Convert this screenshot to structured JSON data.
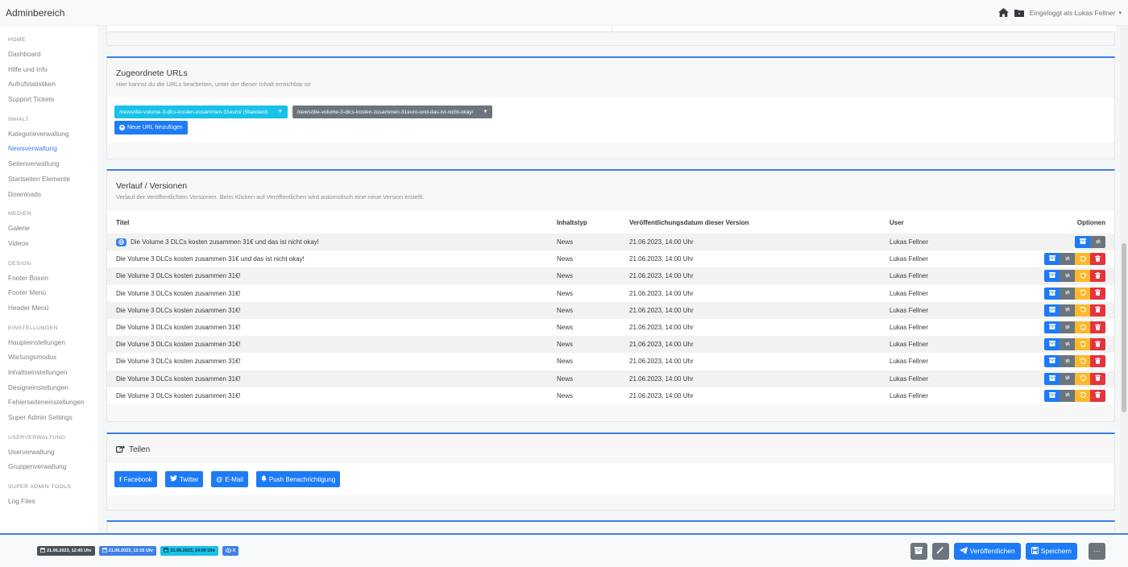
{
  "app": {
    "title": "Adminbereich",
    "user_label": "Eingeloggt als Lukas Fellner"
  },
  "sidebar": [
    {
      "heading": "HOME",
      "items": [
        "Dashboard",
        "Hilfe und Info",
        "Aufrufstatistiken",
        "Support Tickets"
      ]
    },
    {
      "heading": "INHALT",
      "items": [
        "Kategorieverwaltung",
        "Newsverwaltung",
        "Seitenverwaltung",
        "Startseiten Elemente",
        "Downloads"
      ]
    },
    {
      "heading": "MEDIEN",
      "items": [
        "Galerie",
        "Videos"
      ]
    },
    {
      "heading": "DESIGN",
      "items": [
        "Footer Boxen",
        "Footer Menü",
        "Header Menü"
      ]
    },
    {
      "heading": "EINSTELLUNGEN",
      "items": [
        "Haupteinstellungen",
        "Wartungsmodus",
        "Inhaltseinstellungen",
        "Designeinstellungen",
        "Fehlerseiteneinstellungen",
        "Super Admin Settings"
      ]
    },
    {
      "heading": "USERVERWALTUNG",
      "items": [
        "Userverwaltung",
        "Gruppenverwaltung"
      ]
    },
    {
      "heading": "SUPER ADMIN TOOLS",
      "items": [
        "Log Files"
      ]
    }
  ],
  "sidebar_active": "Newsverwaltung",
  "urls": {
    "title": "Zugeordnete URLs",
    "subtitle": "Hier kannst du die URLs bearbeiten, unter der dieser Inhalt erreichbar ist",
    "primary": "/news/die-volume-3-dlcs-kosten-zusammen-31euro/ (Standard)",
    "secondary": "/news/die-volume-3-dlcs-kosten-zusammen-31euro-und-das-ist-nicht-okay/",
    "add_label": "Neue URL hinzufügen"
  },
  "versions": {
    "title": "Verlauf / Versionen",
    "subtitle": "Verlauf der veröffentlichten Versionen. Beim Klicken auf Veröffentlichen wird automstisch eine neue Version erstellt.",
    "headers": {
      "title": "Titel",
      "type": "Inhaltstyp",
      "date": "Veröffentlichungsdatum dieser Version",
      "user": "User",
      "options": "Optionen"
    },
    "rows": [
      {
        "title": "Die Volume 3 DLCs kosten zusammen 31€ und das ist nicht okay!",
        "type": "News",
        "date": "21.06.2023, 14:00 Uhr",
        "user": "Lukas Fellner",
        "current": true
      },
      {
        "title": "Die Volume 3 DLCs kosten zusammen 31€ und das ist nicht okay!",
        "type": "News",
        "date": "21.06.2023, 14:00 Uhr",
        "user": "Lukas Fellner",
        "current": false
      },
      {
        "title": "Die Volume 3 DLCs kosten zusammen 31€!",
        "type": "News",
        "date": "21.06.2023, 14:00 Uhr",
        "user": "Lukas Fellner",
        "current": false
      },
      {
        "title": "Die Volume 3 DLCs kosten zusammen 31€!",
        "type": "News",
        "date": "21.06.2023, 14:00 Uhr",
        "user": "Lukas Fellner",
        "current": false
      },
      {
        "title": "Die Volume 3 DLCs kosten zusammen 31€!",
        "type": "News",
        "date": "21.06.2023, 14:00 Uhr",
        "user": "Lukas Fellner",
        "current": false
      },
      {
        "title": "Die Volume 3 DLCs kosten zusammen 31€!",
        "type": "News",
        "date": "21.06.2023, 14:00 Uhr",
        "user": "Lukas Fellner",
        "current": false
      },
      {
        "title": "Die Volume 3 DLCs kosten zusammen 31€!",
        "type": "News",
        "date": "21.06.2023, 14:00 Uhr",
        "user": "Lukas Fellner",
        "current": false
      },
      {
        "title": "Die Volume 3 DLCs kosten zusammen 31€!",
        "type": "News",
        "date": "21.06.2023, 14:00 Uhr",
        "user": "Lukas Fellner",
        "current": false
      },
      {
        "title": "Die Volume 3 DLCs kosten zusammen 31€!",
        "type": "News",
        "date": "21.06.2023, 14:00 Uhr",
        "user": "Lukas Fellner",
        "current": false
      },
      {
        "title": "Die Volume 3 DLCs kosten zusammen 31€!",
        "type": "News",
        "date": "21.06.2023, 14:00 Uhr",
        "user": "Lukas Fellner",
        "current": false
      }
    ]
  },
  "share": {
    "title": "Teilen",
    "buttons": [
      {
        "icon": "facebook-icon",
        "label": "Facebook"
      },
      {
        "icon": "twitter-icon",
        "label": "Twitter"
      },
      {
        "icon": "at-icon",
        "label": "E-Mail"
      },
      {
        "icon": "bell-icon",
        "label": "Push Benachrichtigung"
      }
    ]
  },
  "footer": {
    "badges": [
      {
        "icon": "calendar-plus-icon",
        "label": "21.06.2023, 12:45 Uhr",
        "style": "dark"
      },
      {
        "icon": "calendar-edit-icon",
        "label": "21.06.2023, 13:15 Uhr",
        "style": "blue"
      },
      {
        "icon": "calendar-check-icon",
        "label": "21.06.2023, 14:00 Uhr",
        "style": "cyan"
      },
      {
        "icon": "eye-icon",
        "label": "6",
        "style": "blue"
      }
    ],
    "publish_label": "Veröffentlichen",
    "save_label": "Speichern",
    "more_label": "···"
  },
  "colors": {
    "accent": "#3f80ea",
    "primary_button": "#1e7bf6",
    "cyan": "#17c1e8",
    "secondary": "#6c757d",
    "warning": "#fcb92c",
    "danger": "#e5343d"
  }
}
